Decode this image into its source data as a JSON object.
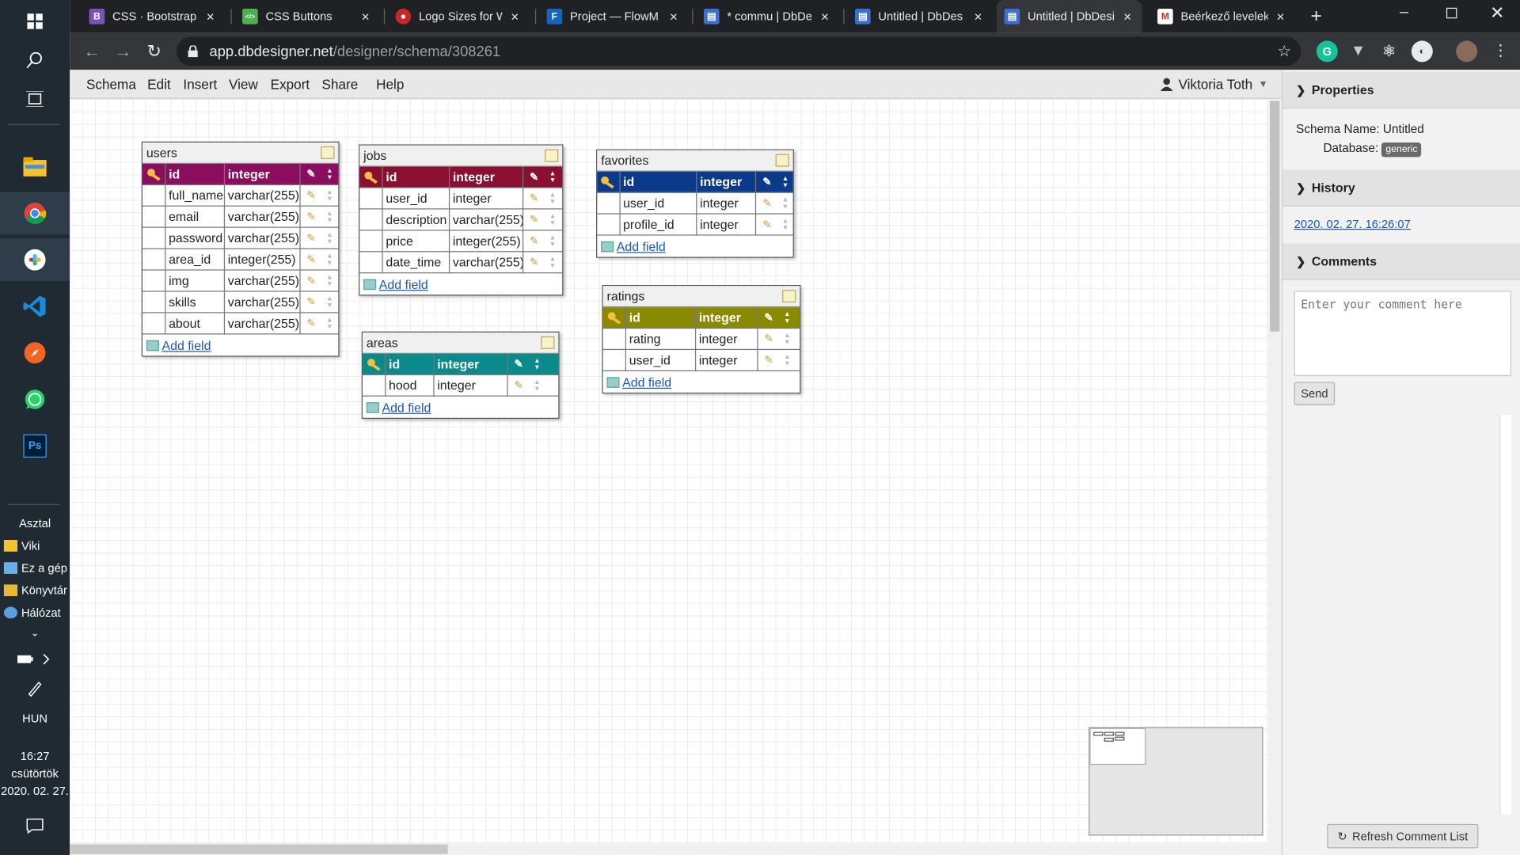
{
  "taskbar": {
    "icons": [
      "windows-start-icon",
      "search-icon",
      "task-view-icon",
      "file-explorer-icon",
      "chrome-icon",
      "slack-icon",
      "vscode-icon",
      "compass-icon",
      "whatsapp-icon",
      "photoshop-icon"
    ],
    "ps_label": "Ps",
    "desktop_label": "Asztal",
    "desktop_items": [
      "Viki",
      "Ez a gép",
      "Könyvtár",
      "Hálózat"
    ],
    "lang": "HUN",
    "time": "16:27",
    "day": "csütörtök",
    "date": "2020. 02. 27."
  },
  "browser": {
    "tabs": [
      {
        "title": "CSS · Bootstrap",
        "favicon_color": "#7952b3",
        "favicon_text": "B"
      },
      {
        "title": "CSS Buttons",
        "favicon_color": "#4caf50",
        "favicon_text": "</>"
      },
      {
        "title": "Logo Sizes for W",
        "favicon_color": "#c62828",
        "favicon_text": "●"
      },
      {
        "title": "Project — FlowM",
        "favicon_color": "#1565c0",
        "favicon_text": "F"
      },
      {
        "title": "* commu | DbDe",
        "favicon_color": "#3b6fd0",
        "favicon_text": "▤"
      },
      {
        "title": "Untitled | DbDes",
        "favicon_color": "#3b6fd0",
        "favicon_text": "▤"
      },
      {
        "title": "Untitled | DbDesi",
        "favicon_color": "#3b6fd0",
        "favicon_text": "▤"
      },
      {
        "title": "Beérkező levelek",
        "favicon_color": "#d93025",
        "favicon_text": "M"
      }
    ],
    "url_host": "app.dbdesigner.net",
    "url_path": "/designer/schema/308261"
  },
  "app": {
    "menu": [
      "Schema",
      "Edit",
      "Insert",
      "View",
      "Export",
      "Share",
      "Help"
    ],
    "user": "Viktoria Toth",
    "add_field_label": "Add field"
  },
  "tables": {
    "users": {
      "name": "users",
      "color": "#8b0e5e",
      "fields": [
        {
          "name": "id",
          "type": "integer"
        },
        {
          "name": "full_name",
          "type": "varchar(255)"
        },
        {
          "name": "email",
          "type": "varchar(255)"
        },
        {
          "name": "password",
          "type": "varchar(255)"
        },
        {
          "name": "area_id",
          "type": "integer(255)"
        },
        {
          "name": "img",
          "type": "varchar(255)"
        },
        {
          "name": "skills",
          "type": "varchar(255)"
        },
        {
          "name": "about",
          "type": "varchar(255)"
        }
      ]
    },
    "jobs": {
      "name": "jobs",
      "color": "#8b0e33",
      "fields": [
        {
          "name": "id",
          "type": "integer"
        },
        {
          "name": "user_id",
          "type": "integer"
        },
        {
          "name": "description",
          "type": "varchar(255)"
        },
        {
          "name": "price",
          "type": "integer(255)"
        },
        {
          "name": "date_time",
          "type": "varchar(255)"
        }
      ]
    },
    "areas": {
      "name": "areas",
      "color": "#0a8a8a",
      "fields": [
        {
          "name": "id",
          "type": "integer"
        },
        {
          "name": "hood",
          "type": "integer"
        }
      ]
    },
    "favorites": {
      "name": "favorites",
      "color": "#0b3a8a",
      "fields": [
        {
          "name": "id",
          "type": "integer"
        },
        {
          "name": "user_id",
          "type": "integer"
        },
        {
          "name": "profile_id",
          "type": "integer"
        }
      ]
    },
    "ratings": {
      "name": "ratings",
      "color": "#8a8a00",
      "fields": [
        {
          "name": "id",
          "type": "integer"
        },
        {
          "name": "rating",
          "type": "integer"
        },
        {
          "name": "user_id",
          "type": "integer"
        }
      ]
    }
  },
  "panel": {
    "properties_title": "Properties",
    "schema_name_label": "Schema Name: Untitled",
    "database_label": "Database:",
    "database_value": "generic",
    "history_title": "History",
    "history_entry": "2020. 02. 27. 16:26:07",
    "comments_title": "Comments",
    "comment_placeholder": "Enter your comment here",
    "send_label": "Send",
    "refresh_label": "Refresh Comment List"
  }
}
